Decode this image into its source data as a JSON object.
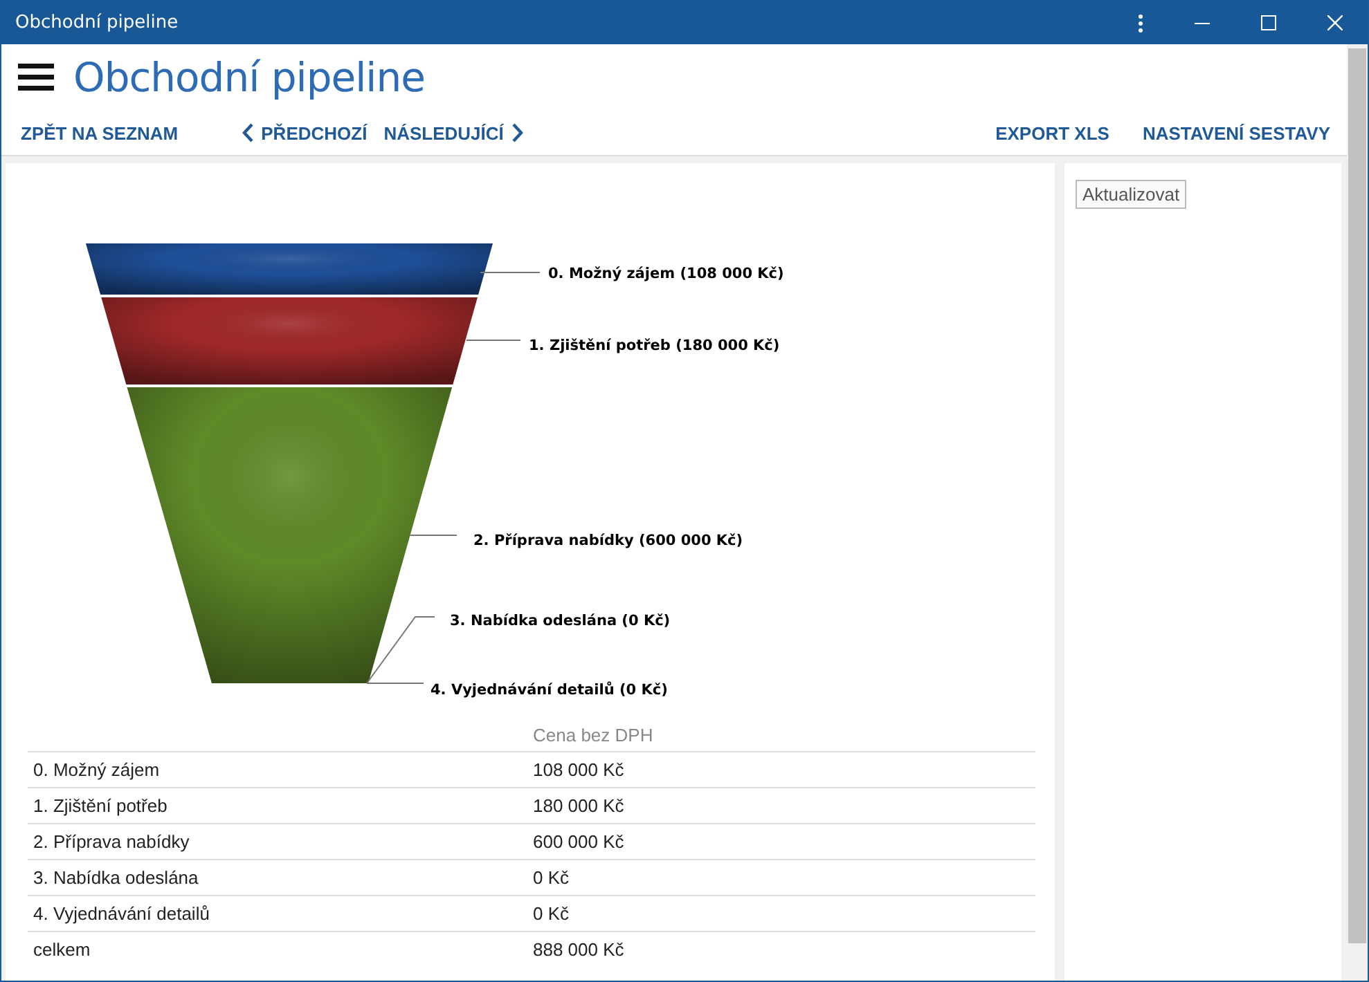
{
  "window": {
    "title": "Obchodní pipeline"
  },
  "header": {
    "title": "Obchodní pipeline"
  },
  "nav": {
    "back": "ZPĚT NA SEZNAM",
    "previous": "PŘEDCHOZÍ",
    "next": "NÁSLEDUJÍCÍ",
    "export": "EXPORT XLS",
    "settings": "NASTAVENÍ SESTAVY"
  },
  "funnel": {
    "segments": [
      {
        "label": "0. Možný zájem (108 000 Kč)",
        "color": "#1e4f98"
      },
      {
        "label": "1. Zjištění potřeb (180 000 Kč)",
        "color": "#a0282a"
      },
      {
        "label": "2. Příprava nabídky (600 000 Kč)",
        "color": "#5f8a28"
      },
      {
        "label": "3. Nabídka odeslána (0 Kč)"
      },
      {
        "label": "4. Vyjednávání detailů (0 Kč)"
      }
    ]
  },
  "table": {
    "columns": [
      "Cena bez DPH"
    ],
    "rows": [
      {
        "name": "0. Možný zájem",
        "value": "108 000 Kč"
      },
      {
        "name": "1. Zjištění potřeb",
        "value": "180 000 Kč"
      },
      {
        "name": "2. Příprava nabídky",
        "value": "600 000 Kč"
      },
      {
        "name": "3. Nabídka odeslána",
        "value": "0 Kč"
      },
      {
        "name": "4. Vyjednávání detailů",
        "value": "0 Kč"
      },
      {
        "name": "celkem",
        "value": "888 000 Kč"
      }
    ]
  },
  "side": {
    "refresh": "Aktualizovat"
  }
}
